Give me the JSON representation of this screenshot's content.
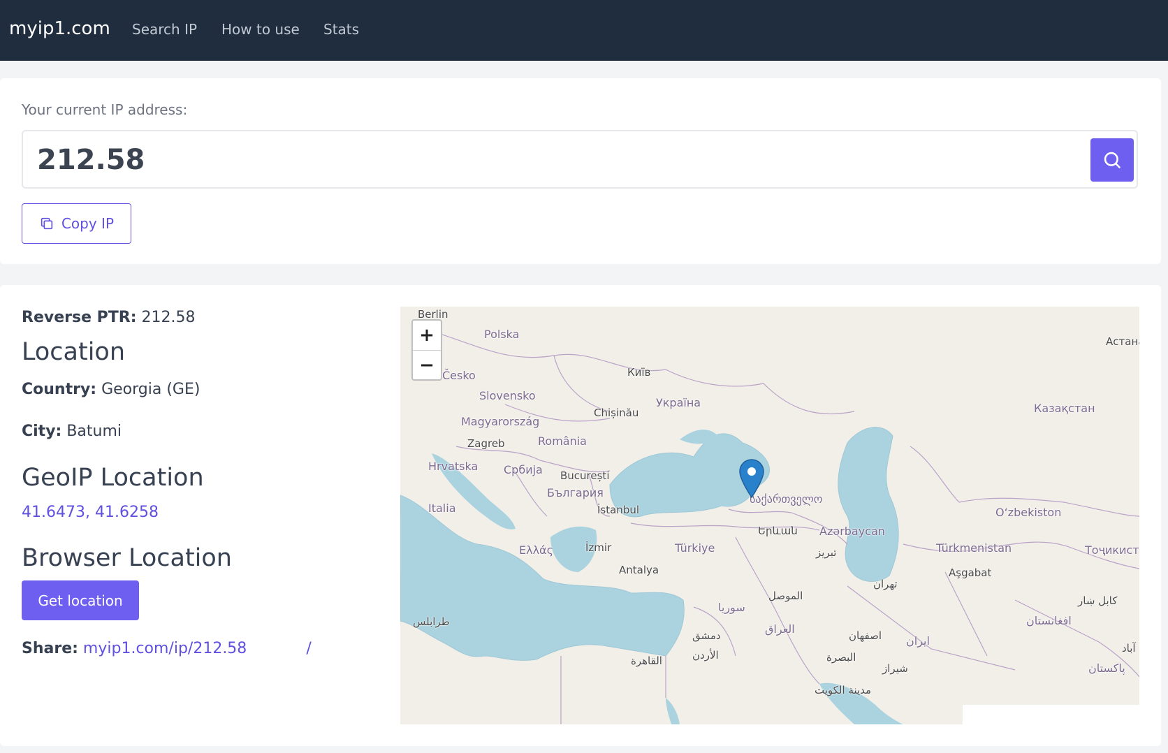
{
  "nav": {
    "brand": "myip1.com",
    "links": [
      "Search IP",
      "How to use",
      "Stats"
    ]
  },
  "ip_card": {
    "label": "Your current IP address:",
    "ip": "212.58",
    "copy_label": "Copy IP"
  },
  "details": {
    "reverse_ptr_label": "Reverse PTR:",
    "reverse_ptr": "212.58",
    "location_heading": "Location",
    "country_label": "Country:",
    "country": "Georgia (GE)",
    "city_label": "City:",
    "city": "Batumi",
    "geoip_heading": "GeoIP Location",
    "coords": "41.6473, 41.6258",
    "browser_heading": "Browser Location",
    "get_location_label": "Get location",
    "share_label": "Share:",
    "share_link": "myip1.com/ip/212.58",
    "share_sep": "/"
  },
  "map": {
    "zoom_in": "+",
    "zoom_out": "−",
    "marker_lat": 41.6473,
    "marker_lon": 41.6258,
    "labels": {
      "berlin": "Berlin",
      "polska": "Polska",
      "cesko": "Česko",
      "kyiv": "Київ",
      "slovensko": "Slovensko",
      "ukraina": "Україна",
      "astana": "Астана",
      "kazakhstan": "Казақстан",
      "magyarorszag": "Magyarország",
      "chisinau": "Chișinău",
      "zagreb": "Zagreb",
      "romania": "România",
      "hrvatska": "Hrvatska",
      "srbija": "Србија",
      "bucuresti": "București",
      "bulgaria": "България",
      "italia": "Italia",
      "istanbul": "İstanbul",
      "sakartvelo": "საქართველო",
      "uzbekiston": "O‘zbekiston",
      "yerevan": "Երևան",
      "azarbaycan": "Azərbaycan",
      "ellas": "Ελλάς",
      "izmir": "İzmir",
      "turkiye": "Türkiye",
      "turkmenistan": "Türkmenistan",
      "tojikiston": "Тоҷикистон",
      "tabriz": "تبریز",
      "ashgabat": "Aşgabat",
      "antalya": "Antalya",
      "tehran": "تهران",
      "mosul": "الموصل",
      "syria": "سوريا",
      "kabul": "کابل ښار",
      "tarabulus": "طرابلس",
      "afghanistan": "افغانستان",
      "iraq": "العراق",
      "isfahan": "اصفهان",
      "iran": "ایران",
      "dimashq": "دمشق",
      "urdun": "الأردن",
      "basra": "البصرة",
      "qahira": "القاهرة",
      "shiraz": "شیراز",
      "pakistan": "پاکستان",
      "kuwait": "مدينة الكويت",
      "abad": "آباد"
    }
  }
}
